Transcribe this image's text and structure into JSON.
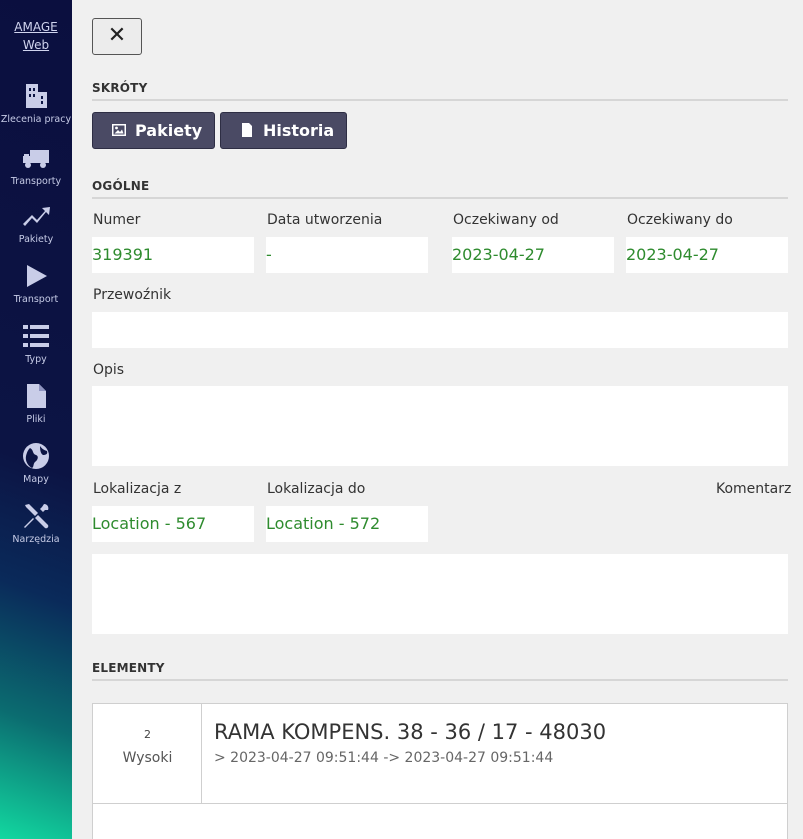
{
  "sidebar": {
    "brand_line1": "AMAGE",
    "brand_line2": "Web",
    "items": [
      {
        "label": "Zlecenia pracy",
        "icon": "building-icon"
      },
      {
        "label": "Transporty",
        "icon": "truck-icon"
      },
      {
        "label": "Pakiety",
        "icon": "trend-icon"
      },
      {
        "label": "Transport",
        "icon": "play-icon"
      },
      {
        "label": "Typy",
        "icon": "list-icon"
      },
      {
        "label": "Pliki",
        "icon": "file-icon"
      },
      {
        "label": "Mapy",
        "icon": "globe-icon"
      },
      {
        "label": "Narzędzia",
        "icon": "tools-icon"
      }
    ]
  },
  "header": {
    "close_label": "✕"
  },
  "shortcuts": {
    "title": "SKRÓTY",
    "packages_label": "Pakiety",
    "history_label": "Historia"
  },
  "general": {
    "title": "OGÓLNE",
    "number_label": "Numer",
    "number_value": "319391",
    "created_label": "Data utworzenia",
    "created_value": "-",
    "expected_from_label": "Oczekiwany od",
    "expected_from_value": "2023-04-27",
    "expected_to_label": "Oczekiwany do",
    "expected_to_value": "2023-04-27",
    "carrier_label": "Przewoźnik",
    "carrier_value": "",
    "description_label": "Opis",
    "description_value": "",
    "location_from_label": "Lokalizacja z",
    "location_from_value": "Location - 567",
    "location_to_label": "Lokalizacja do",
    "location_to_value": "Location - 572",
    "comment_label": "Komentarz",
    "comment_value": ""
  },
  "elements": {
    "title": "ELEMENTY",
    "items": [
      {
        "number": "2",
        "priority": "Wysoki",
        "name": "RAMA KOMPENS. 38 - 36 / 17 - 48030",
        "dates": "> 2023-04-27 09:51:44 -> 2023-04-27 09:51:44"
      }
    ]
  },
  "colors": {
    "sidebar_top": "#0b0f3f",
    "sidebar_bottom": "#12d8a0",
    "button_dark": "#4a4a64",
    "value_green": "#2e8b2e"
  }
}
